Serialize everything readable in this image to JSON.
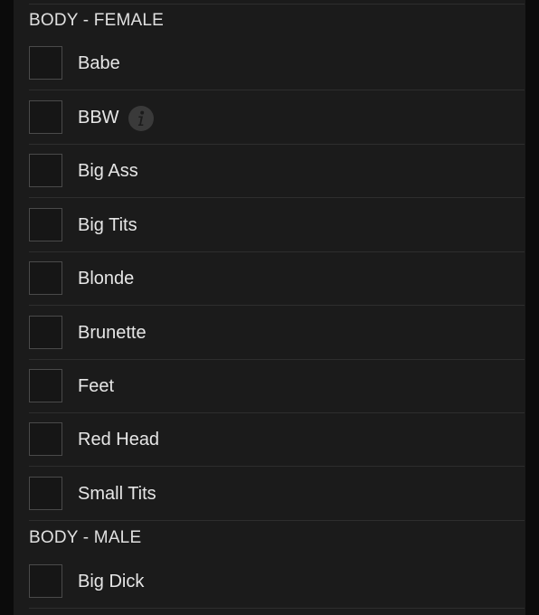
{
  "sections": [
    {
      "title": "BODY - FEMALE",
      "items": [
        {
          "label": "Babe",
          "checked": false
        },
        {
          "label": "BBW",
          "checked": false,
          "icon": "info-icon"
        },
        {
          "label": "Big Ass",
          "checked": false
        },
        {
          "label": "Big Tits",
          "checked": false
        },
        {
          "label": "Blonde",
          "checked": false
        },
        {
          "label": "Brunette",
          "checked": false
        },
        {
          "label": "Feet",
          "checked": false
        },
        {
          "label": "Red Head",
          "checked": false
        },
        {
          "label": "Small Tits",
          "checked": false
        }
      ]
    },
    {
      "title": "BODY - MALE",
      "items": [
        {
          "label": "Big Dick",
          "checked": false
        }
      ]
    }
  ],
  "colors": {
    "background": "#0b0b0b",
    "panel": "#1b1b1b",
    "divider": "#2e2e2e",
    "checkbox_border": "#4a4a4a",
    "text": "#e6e6e6",
    "info_icon": "#3a3a3a"
  }
}
